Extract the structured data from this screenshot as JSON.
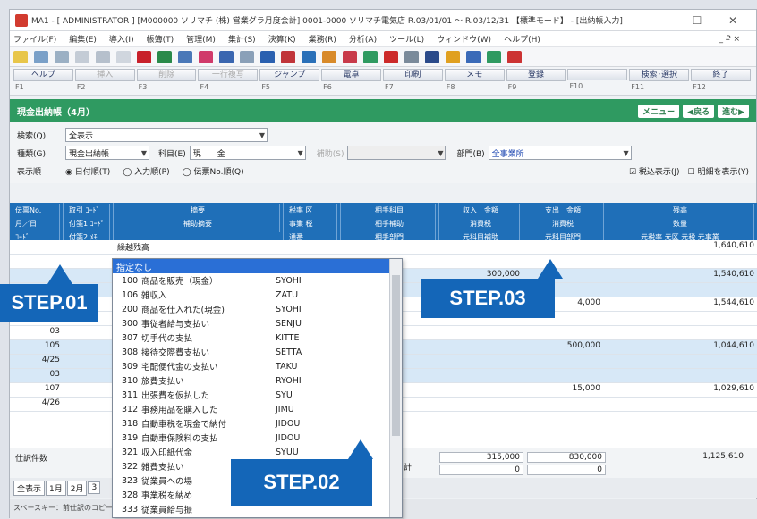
{
  "window": {
    "title": "MA1 - [ ADMINISTRATOR ] [M000000 ソリマチ (株) 営業グラ月度会計] 0001-0000 ソリマチ電気店 R.03/01/01 ～ R.03/12/31 【標準モード】 - [出納帳入力]",
    "min": "—",
    "max": "☐",
    "close": "✕"
  },
  "menu": [
    "ファイル(F)",
    "編集(E)",
    "導入(I)",
    "帳簿(T)",
    "管理(M)",
    "集計(S)",
    "決算(K)",
    "業務(R)",
    "分析(A)",
    "ツール(L)",
    "ウィンドウ(W)",
    "ヘルプ(H)"
  ],
  "menu_right": "_ ₽ ×",
  "fkeys": [
    {
      "label": "ヘルプ",
      "key": "F1"
    },
    {
      "label": "挿入",
      "key": "F2"
    },
    {
      "label": "削除",
      "key": "F3"
    },
    {
      "label": "一行複写",
      "key": "F4"
    },
    {
      "label": "ジャンプ",
      "key": "F5"
    },
    {
      "label": "電卓",
      "key": "F6"
    },
    {
      "label": "印刷",
      "key": "F7"
    },
    {
      "label": "メモ",
      "key": "F8"
    },
    {
      "label": "登録",
      "key": "F9"
    },
    {
      "label": "",
      "key": "F10"
    },
    {
      "label": "検索･選択",
      "key": "F11"
    },
    {
      "label": "終了",
      "key": "F12"
    }
  ],
  "section": {
    "title": "現金出納帳（4月）",
    "menu": "メニュー",
    "back": "◀戻る",
    "next": "進む▶"
  },
  "form": {
    "search_label": "検索(Q)",
    "search_value": "全表示",
    "type_label": "種類(G)",
    "type_value": "現金出納帳",
    "account_label": "科目(E)",
    "account_value": "現　　金",
    "sub_label": "補助(S)",
    "sub_value": "",
    "dept_label": "部門(B)",
    "dept_value": "全事業所",
    "order_label": "表示順",
    "order_opts": [
      "◉ 日付順(T)",
      "◯ 入力順(P)",
      "◯ 伝票No.順(Q)"
    ],
    "right_opts": "☑ 税込表示(J)　☐ 明細を表示(Y)"
  },
  "grid_header": [
    [
      "伝票No.",
      "月／日",
      "ｺｰﾄﾞ"
    ],
    [
      "取引 ｺｰﾄﾞ",
      "付箋1 ｺｰﾄﾞ",
      "付箋2 ﾒﾓ"
    ],
    [
      "摘要",
      "補助摘要",
      ""
    ],
    [
      "税率 区",
      "事業 税",
      "通番"
    ],
    [
      "相手科目",
      "相手補助",
      "相手部門"
    ],
    [
      "収入　金額",
      "消費税",
      "元科目補助"
    ],
    [
      "支出　金額",
      "消費税",
      "元科目部門"
    ],
    [
      "残高",
      "数量",
      "元税率 元区 元税 元事業"
    ]
  ],
  "grid_rows": [
    {
      "c": [
        "",
        "",
        "繰越残高",
        "",
        "",
        "",
        "",
        "1,640,610"
      ],
      "blue": false
    },
    {
      "c": [
        "",
        "",
        "",
        "",
        "",
        "",
        "",
        ""
      ],
      "blue": false
    },
    {
      "c": [
        "",
        "",
        "",
        "",
        "",
        "300,000",
        "",
        "1,540,610"
      ],
      "blue": true
    },
    {
      "c": [
        "",
        "",
        "",
        "",
        "",
        "",
        "",
        ""
      ],
      "blue": true
    },
    {
      "c": [
        "",
        "",
        "",
        "",
        "",
        "",
        "4,000",
        "1,544,610"
      ],
      "blue": false
    },
    {
      "c": [
        "4/25",
        "",
        "",
        "",
        "",
        "",
        "",
        ""
      ],
      "blue": false
    },
    {
      "c": [
        "03",
        "",
        "",
        "",
        "",
        "",
        "",
        ""
      ],
      "blue": false
    },
    {
      "c": [
        "105",
        "",
        "",
        "",
        "",
        "",
        "500,000",
        "1,044,610"
      ],
      "blue": true
    },
    {
      "c": [
        "4/25",
        "",
        "",
        "",
        "",
        "",
        "",
        ""
      ],
      "blue": true
    },
    {
      "c": [
        "03",
        "",
        "",
        "",
        "",
        "",
        "",
        ""
      ],
      "blue": true
    },
    {
      "c": [
        "107",
        "",
        "",
        "",
        "",
        "",
        "15,000",
        "1,029,610"
      ],
      "blue": false
    },
    {
      "c": [
        "4/26",
        "",
        "",
        "",
        "",
        "",
        "",
        ""
      ],
      "blue": false
    }
  ],
  "summary": {
    "label": "仕訳件数",
    "total_label": "計",
    "in1": "315,000",
    "out1": "830,000",
    "bal1": "1,125,610",
    "in2": "0",
    "out2": "0"
  },
  "tabs": [
    "全表示",
    "1月",
    "2月",
    "3"
  ],
  "status": "スペースキー：前仕訳のコピー",
  "dropdown": {
    "header": "指定なし",
    "items": [
      [
        "100",
        "商品を販売（現金）",
        "SYOHI"
      ],
      [
        "106",
        "雑収入",
        "ZATU"
      ],
      [
        "200",
        "商品を仕入れた(現金)",
        "SYOHI"
      ],
      [
        "300",
        "事従者給与支払い",
        "SENJU"
      ],
      [
        "307",
        "切手代の支払",
        "KITTE"
      ],
      [
        "308",
        "接待交際費支払い",
        "SETTA"
      ],
      [
        "309",
        "宅配便代金の支払い",
        "TAKU"
      ],
      [
        "310",
        "旅費支払い",
        "RYOHI"
      ],
      [
        "311",
        "出張費を仮払した",
        "SYU"
      ],
      [
        "312",
        "事務用品を購入した",
        "JIMU"
      ],
      [
        "318",
        "自動車税を現金で納付",
        "JIDOU"
      ],
      [
        "319",
        "自動車保険料の支払",
        "JIDOU"
      ],
      [
        "321",
        "収入印紙代金",
        "SYUU"
      ],
      [
        "322",
        "雑費支払い",
        "ZAPPI"
      ],
      [
        "323",
        "従業員への場",
        ""
      ],
      [
        "328",
        "事業税を納め",
        ""
      ],
      [
        "333",
        "従業員給与振",
        ""
      ]
    ]
  },
  "callouts": {
    "step1": "STEP.01",
    "step2": "STEP.02",
    "step3": "STEP.03"
  },
  "colors": {
    "header_blue": "#1f6fb8",
    "section_green": "#2f9a61",
    "callout_blue": "#1466b8",
    "row_blue": "#d7e8f7"
  }
}
